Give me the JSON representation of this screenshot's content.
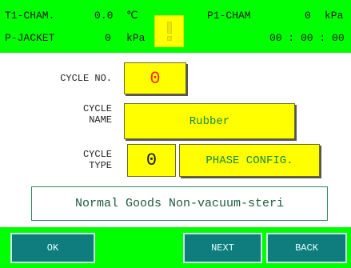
{
  "status": {
    "t1_label": "T1-CHAM.",
    "t1_value": "0.0",
    "t1_unit": "℃",
    "p1_label": "P1-CHAM",
    "p1_value": "0",
    "p1_unit": "kPa",
    "pj_label": "P-JACKET",
    "pj_value": "0",
    "pj_unit": "kPa",
    "timer": "00 : 00 : 00",
    "alarm_icon": "exclamation-icon"
  },
  "form": {
    "cycle_no_label": "CYCLE NO.",
    "cycle_no_value": "0",
    "cycle_name_label_1": "CYCLE",
    "cycle_name_label_2": "NAME",
    "cycle_name_value": "Rubber",
    "cycle_type_label_1": "CYCLE",
    "cycle_type_label_2": "TYPE",
    "cycle_type_value": "0",
    "phase_config_label": "PHASE CONFIG."
  },
  "message": "Normal Goods Non-vacuum-steri",
  "buttons": {
    "ok": "OK",
    "next": "NEXT",
    "back": "BACK"
  },
  "colors": {
    "bar_green": "#00ff00",
    "field_yellow": "#ffff00",
    "button_teal": "#0f7d7d",
    "value_red": "#ff2a00",
    "value_green": "#1a8a3a"
  }
}
